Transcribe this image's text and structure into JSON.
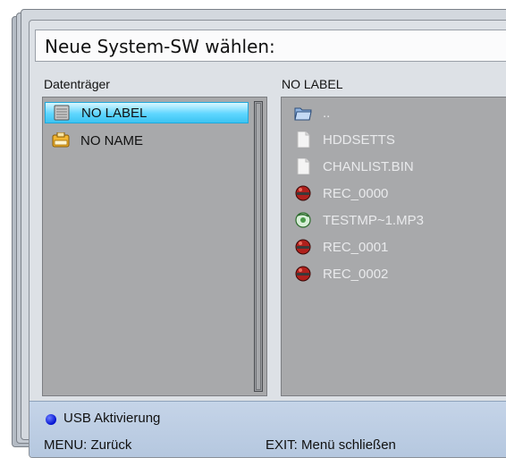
{
  "dialog": {
    "title": "Neue System-SW wählen:"
  },
  "left_panel": {
    "header": "Datenträger",
    "items": [
      {
        "label": "NO LABEL",
        "icon": "drive-icon",
        "selected": true
      },
      {
        "label": "NO NAME",
        "icon": "usb-drive-icon",
        "selected": false
      }
    ]
  },
  "right_panel": {
    "header": "NO LABEL",
    "items": [
      {
        "label": "..",
        "icon": "folder-up-icon"
      },
      {
        "label": "HDDSETTS",
        "icon": "file-icon"
      },
      {
        "label": "CHANLIST.BIN",
        "icon": "file-icon"
      },
      {
        "label": "REC_0000",
        "icon": "record-icon"
      },
      {
        "label": "TESTMP~1.MP3",
        "icon": "audio-icon"
      },
      {
        "label": "REC_0001",
        "icon": "record-icon"
      },
      {
        "label": "REC_0002",
        "icon": "record-icon"
      }
    ]
  },
  "footer": {
    "usb_label": "USB Aktivierung",
    "menu_label": "MENU: Zurück",
    "exit_label": "EXIT: Menü schließen"
  },
  "colors": {
    "selection": "#5fd6ff",
    "usb_button": "#0010d0",
    "panel": "#a8a9ab"
  }
}
